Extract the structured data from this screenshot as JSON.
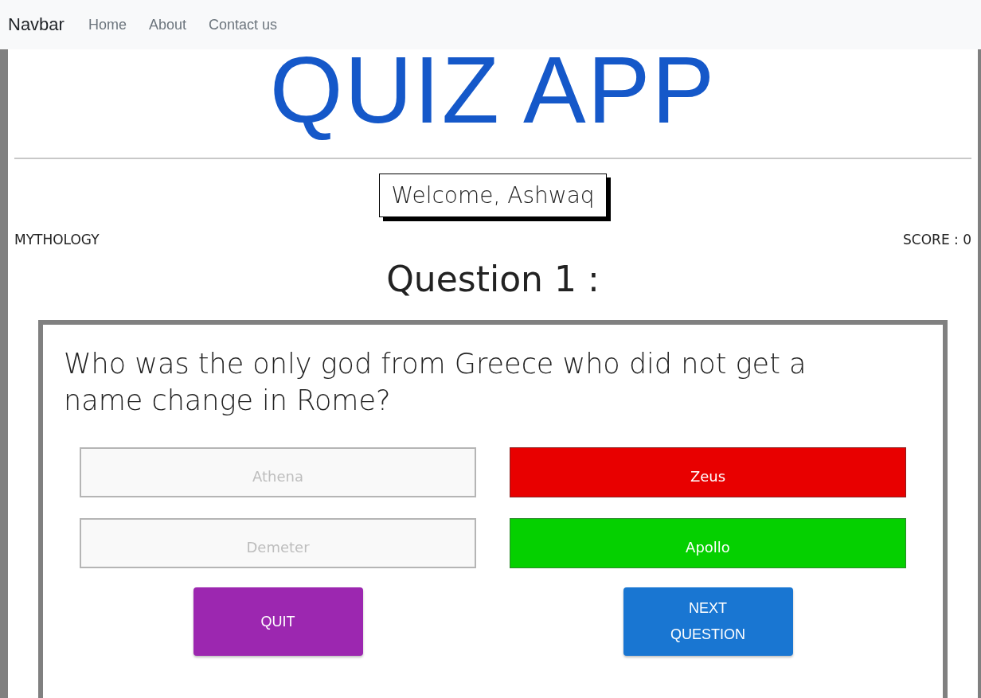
{
  "navbar": {
    "brand": "Navbar",
    "links": [
      "Home",
      "About",
      "Contact us"
    ]
  },
  "title": "QUIZ APP",
  "welcome": "Welcome, Ashwaq",
  "category": "MYTHOLOGY",
  "score": "SCORE : 0",
  "question_heading": "Question 1 :",
  "question": "Who was the only god from Greece who did not get a name change in Rome?",
  "options": [
    {
      "label": "Athena",
      "kind": "disabled"
    },
    {
      "label": "Zeus",
      "kind": "wrong"
    },
    {
      "label": "Demeter",
      "kind": "disabled"
    },
    {
      "label": "Apollo",
      "kind": "correct"
    }
  ],
  "buttons": [
    {
      "label": "QUIT",
      "kind": "quit"
    },
    {
      "label": "NEXT QUESTION",
      "kind": "next"
    }
  ]
}
